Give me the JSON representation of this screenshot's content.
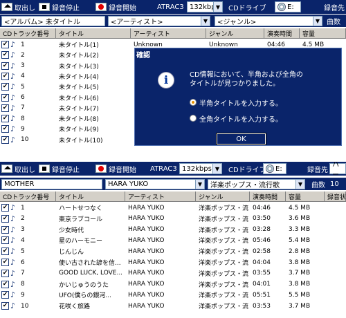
{
  "toolbar": {
    "eject_label": "取出し",
    "stop_label": "録音停止",
    "record_label": "録音開始",
    "codec_label": "ATRAC3",
    "bitrate": "132kbps",
    "drive_label": "CDドライブ",
    "drive_value": "E:",
    "dest_label": "録音先",
    "dest_value": "ハー"
  },
  "columns": [
    "CDトラック番号",
    "タイトル",
    "アーティスト",
    "ジャンル",
    "演奏時間",
    "容量",
    "録音状"
  ],
  "panel1": {
    "album": "<アルバム> 未タイトル",
    "artist": "<アーティスト>",
    "genre": "<ジャンル>",
    "track_count_label": "曲数",
    "rows": [
      {
        "no": "1",
        "title": "未タイトル(1)",
        "artist": "Unknown",
        "genre": "Unknown",
        "time": "04:46",
        "size": "4.5 MB"
      },
      {
        "no": "2",
        "title": "未タイトル(2)",
        "artist": "",
        "genre": "",
        "time": "",
        "size": ""
      },
      {
        "no": "3",
        "title": "未タイトル(3)",
        "artist": "",
        "genre": "",
        "time": "",
        "size": ""
      },
      {
        "no": "4",
        "title": "未タイトル(4)",
        "artist": "",
        "genre": "",
        "time": "",
        "size": ""
      },
      {
        "no": "5",
        "title": "未タイトル(5)",
        "artist": "",
        "genre": "",
        "time": "",
        "size": ""
      },
      {
        "no": "6",
        "title": "未タイトル(6)",
        "artist": "",
        "genre": "",
        "time": "",
        "size": ""
      },
      {
        "no": "7",
        "title": "未タイトル(7)",
        "artist": "",
        "genre": "",
        "time": "",
        "size": ""
      },
      {
        "no": "8",
        "title": "未タイトル(8)",
        "artist": "",
        "genre": "",
        "time": "",
        "size": ""
      },
      {
        "no": "9",
        "title": "未タイトル(9)",
        "artist": "",
        "genre": "",
        "time": "",
        "size": ""
      },
      {
        "no": "10",
        "title": "未タイトル(10)",
        "artist": "",
        "genre": "",
        "time": "",
        "size": ""
      }
    ]
  },
  "dialog": {
    "title": "確認",
    "message_line1": "CD情報において、半角および全角の",
    "message_line2": "タイトルが見つかりました。",
    "option1": "半角タイトルを入力する。",
    "option2": "全角タイトルを入力する。",
    "ok_label": "OK"
  },
  "panel2": {
    "album": "MOTHER",
    "artist": "HARA YUKO",
    "genre": "洋楽ポップス・流行歌",
    "track_count_label": "曲数",
    "track_count": "10",
    "rows": [
      {
        "no": "1",
        "title": "ハートせつなく",
        "artist": "HARA YUKO",
        "genre": "洋楽ポップス・流",
        "time": "04:46",
        "size": "4.5 MB"
      },
      {
        "no": "2",
        "title": "東京ラブコール",
        "artist": "HARA YUKO",
        "genre": "洋楽ポップス・流",
        "time": "03:50",
        "size": "3.6 MB"
      },
      {
        "no": "3",
        "title": "少女時代",
        "artist": "HARA YUKO",
        "genre": "洋楽ポップス・流",
        "time": "03:28",
        "size": "3.3 MB"
      },
      {
        "no": "4",
        "title": "星のハーモニー",
        "artist": "HARA YUKO",
        "genre": "洋楽ポップス・流",
        "time": "05:46",
        "size": "5.4 MB"
      },
      {
        "no": "5",
        "title": "じんじん",
        "artist": "HARA YUKO",
        "genre": "洋楽ポップス・流",
        "time": "02:58",
        "size": "2.8 MB"
      },
      {
        "no": "6",
        "title": "使い古された諺を信...",
        "artist": "HARA YUKO",
        "genre": "洋楽ポップス・流",
        "time": "04:04",
        "size": "3.8 MB"
      },
      {
        "no": "7",
        "title": "GOOD LUCK, LOVE...",
        "artist": "HARA YUKO",
        "genre": "洋楽ポップス・流",
        "time": "03:55",
        "size": "3.7 MB"
      },
      {
        "no": "8",
        "title": "かいじゅうのうた",
        "artist": "HARA YUKO",
        "genre": "洋楽ポップス・流",
        "time": "04:01",
        "size": "3.8 MB"
      },
      {
        "no": "9",
        "title": "UFO(僕らの銀河...",
        "artist": "HARA YUKO",
        "genre": "洋楽ポップス・流",
        "time": "05:51",
        "size": "5.5 MB"
      },
      {
        "no": "10",
        "title": "花咲く旅路",
        "artist": "HARA YUKO",
        "genre": "洋楽ポップス・流",
        "time": "03:53",
        "size": "3.7 MB"
      }
    ]
  }
}
